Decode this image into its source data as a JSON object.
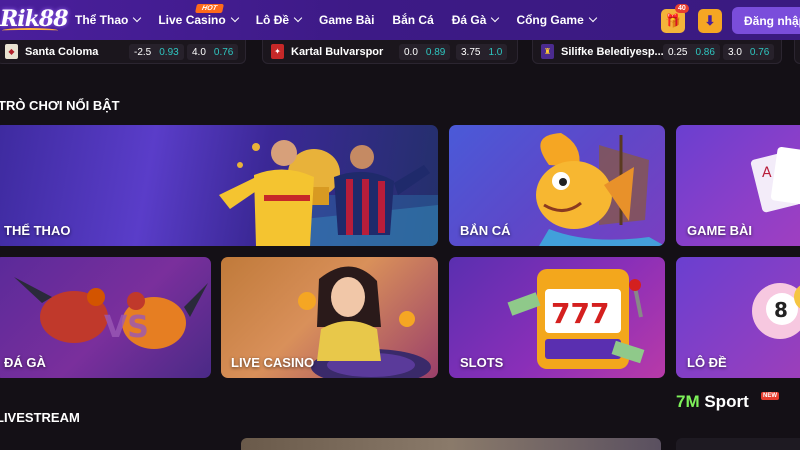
{
  "header": {
    "logo_text": "Rik88",
    "menu": [
      {
        "label": "Thể Thao",
        "has_dropdown": true
      },
      {
        "label": "Live Casino",
        "has_dropdown": true,
        "badge": "HOT"
      },
      {
        "label": "Lô Đề",
        "has_dropdown": true
      },
      {
        "label": "Game Bài",
        "has_dropdown": false
      },
      {
        "label": "Bắn Cá",
        "has_dropdown": false
      },
      {
        "label": "Đá Gà",
        "has_dropdown": true
      },
      {
        "label": "Cổng Game",
        "has_dropdown": true
      }
    ],
    "gift_count": "40",
    "login_label": "Đăng nhập"
  },
  "ticker": [
    {
      "team": "Santa Coloma",
      "odds1": [
        "-2.5",
        "0.93"
      ],
      "odds2": [
        "4.0",
        "0.76"
      ]
    },
    {
      "team": "Kartal Bulvarspor",
      "odds1": [
        "0.0",
        "0.89"
      ],
      "odds2": [
        "3.75",
        "1.0"
      ]
    },
    {
      "team": "Silifke Belediyesp...",
      "odds1": [
        "0.25",
        "0.86"
      ],
      "odds2": [
        "3.0",
        "0.76"
      ]
    }
  ],
  "featured": {
    "title": "TRÒ CHƠI NỔI BẬT",
    "cards": [
      {
        "label": "THỂ THAO"
      },
      {
        "label": "BẮN CÁ"
      },
      {
        "label": "GAME BÀI"
      },
      {
        "label": "ĐÁ GÀ"
      },
      {
        "label": "LIVE CASINO"
      },
      {
        "label": "SLOTS"
      },
      {
        "label": "LÔ ĐỀ"
      }
    ]
  },
  "livestream": {
    "title": "LIVESTREAM"
  },
  "watermark": {
    "prefix": "7M",
    "suffix": " Sport",
    "badge": "NEW"
  },
  "colors": {
    "nav": "#4a1f9c",
    "accent": "#7a4ddb",
    "odds_teal": "#2ec6c0",
    "background": "#141016"
  }
}
